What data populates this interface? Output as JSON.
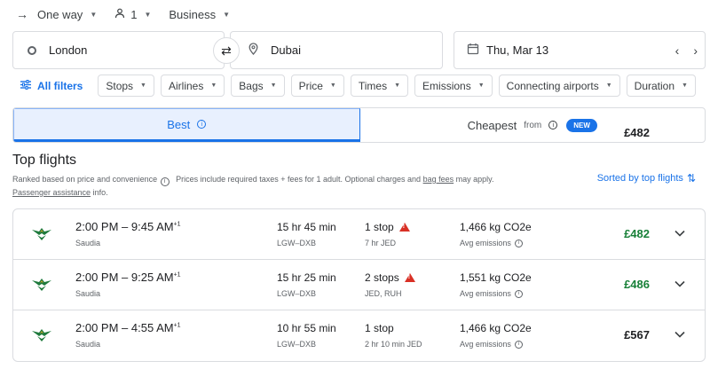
{
  "search": {
    "trip_type": "One way",
    "passengers": "1",
    "cabin": "Business",
    "origin": "London",
    "destination": "Dubai",
    "date": "Thu, Mar 13"
  },
  "filters": {
    "all_filters": "All filters",
    "chips": [
      "Stops",
      "Airlines",
      "Bags",
      "Price",
      "Times",
      "Emissions",
      "Connecting airports",
      "Duration"
    ]
  },
  "tabs": {
    "best": "Best",
    "cheapest": "Cheapest",
    "cheapest_from": "from",
    "cheapest_price": "£482",
    "new_badge": "NEW"
  },
  "results_header": {
    "title": "Top flights",
    "ranked": "Ranked based on price and convenience",
    "prices_note": "Prices include required taxes + fees for 1 adult. Optional charges and",
    "bag_fees": "bag fees",
    "may_apply": "may apply.",
    "passenger_assistance": "Passenger assistance",
    "info_suffix": "info.",
    "sorted": "Sorted by top flights"
  },
  "flights": [
    {
      "times": "2:00 PM – 9:45 AM",
      "day_offset": "+1",
      "airline": "Saudia",
      "duration": "15 hr 45 min",
      "route": "LGW–DXB",
      "stops": "1 stop",
      "warning": true,
      "stop_detail": "7 hr JED",
      "emissions": "1,466 kg CO2e",
      "emissions_label": "Avg emissions",
      "price": "£482",
      "price_color": "#188038"
    },
    {
      "times": "2:00 PM – 9:25 AM",
      "day_offset": "+1",
      "airline": "Saudia",
      "duration": "15 hr 25 min",
      "route": "LGW–DXB",
      "stops": "2 stops",
      "warning": true,
      "stop_detail": "JED, RUH",
      "emissions": "1,551 kg CO2e",
      "emissions_label": "Avg emissions",
      "price": "£486",
      "price_color": "#188038"
    },
    {
      "times": "2:00 PM – 4:55 AM",
      "day_offset": "+1",
      "airline": "Saudia",
      "duration": "10 hr 55 min",
      "route": "LGW–DXB",
      "stops": "1 stop",
      "warning": false,
      "stop_detail": "2 hr 10 min JED",
      "emissions": "1,466 kg CO2e",
      "emissions_label": "Avg emissions",
      "price": "£567",
      "price_color": "#202124"
    }
  ]
}
